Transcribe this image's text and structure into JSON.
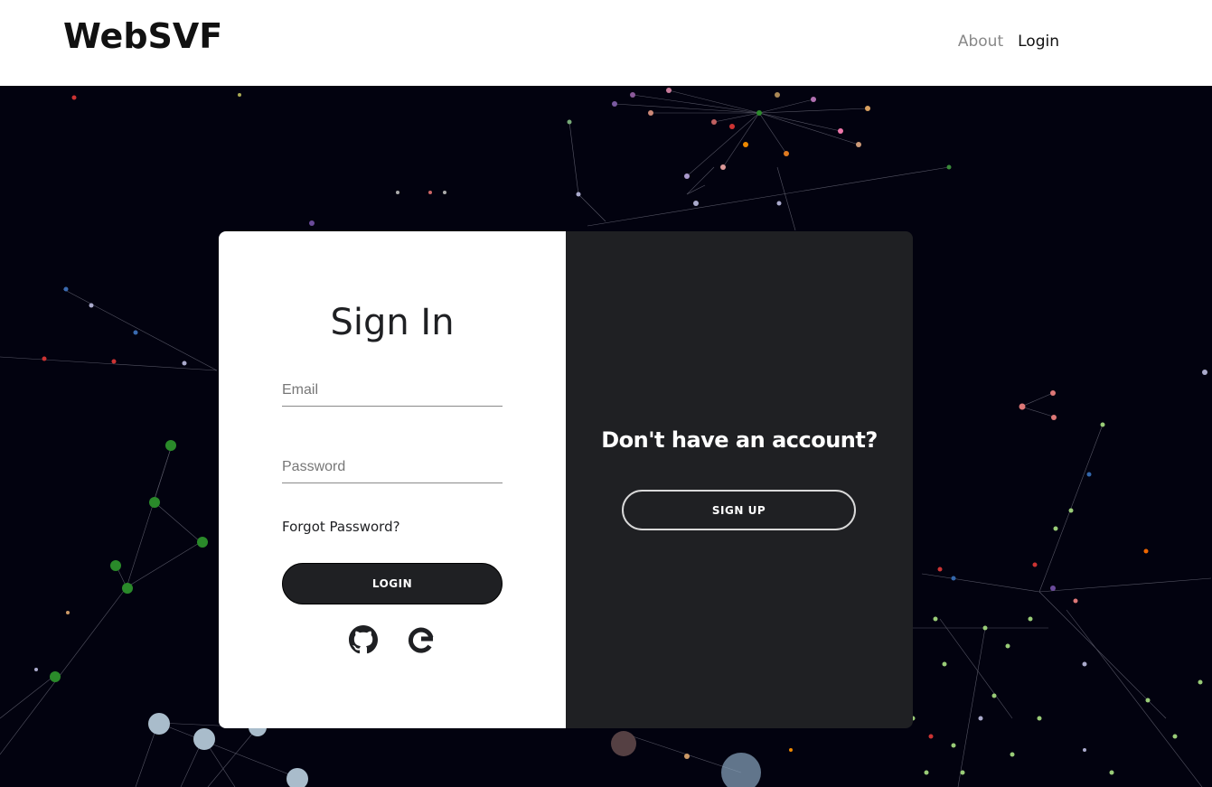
{
  "navbar": {
    "brand": "WebSVF",
    "links": [
      {
        "label": "About"
      },
      {
        "label": "Login"
      }
    ]
  },
  "signin": {
    "title": "Sign In",
    "email_placeholder": "Email",
    "email_value": "",
    "password_placeholder": "Password",
    "password_value": "",
    "forgot_label": "Forgot Password?",
    "login_label": "LOGIN",
    "social": [
      "github-icon",
      "google-icon"
    ]
  },
  "signup": {
    "title": "Don't have an account?",
    "button_label": "SIGN UP"
  },
  "colors": {
    "card_dark": "#1f2023",
    "background": "#02020f",
    "navbar": "#ffffff"
  }
}
